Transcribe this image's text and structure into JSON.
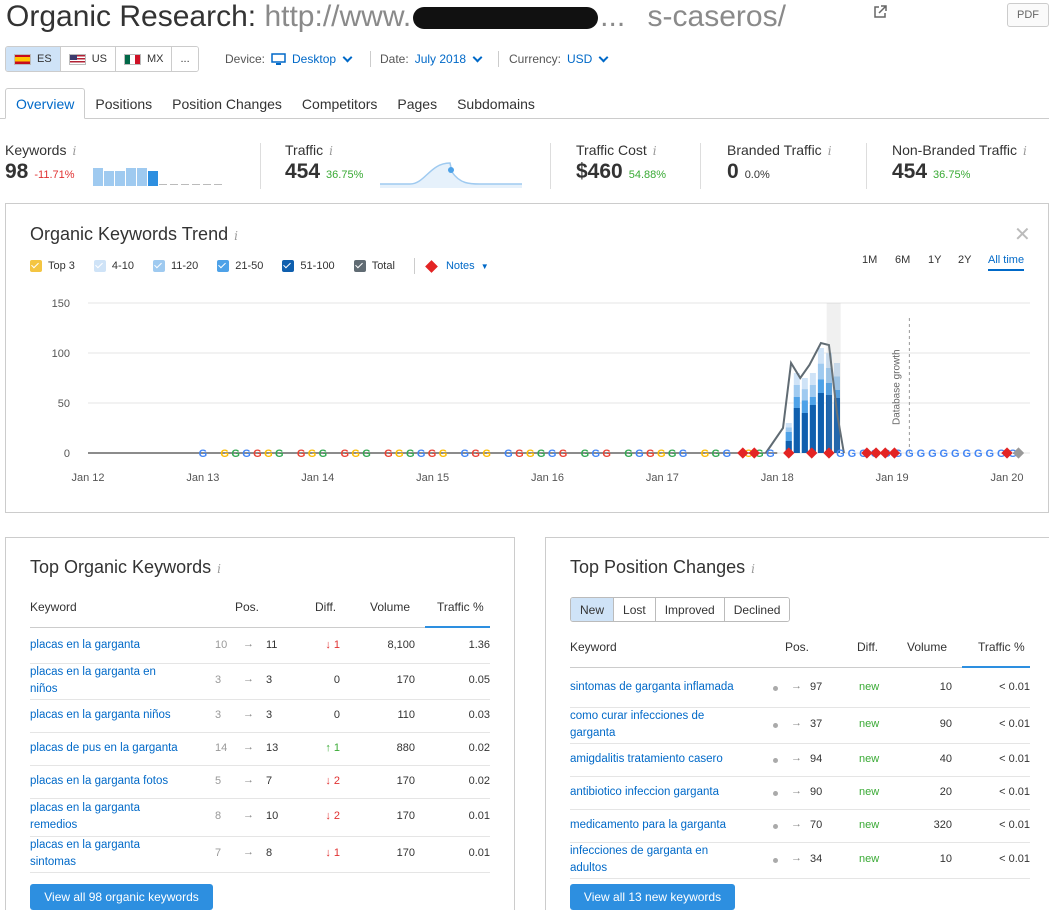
{
  "header": {
    "title_prefix": "Organic Research:",
    "url_start": "http://www.",
    "url_mid": "...",
    "url_end": "s-caseros/",
    "pdf_label": "PDF"
  },
  "databases": [
    {
      "code": "ES",
      "flag": "es",
      "active": true
    },
    {
      "code": "US",
      "flag": "us",
      "active": false
    },
    {
      "code": "MX",
      "flag": "mx",
      "active": false
    },
    {
      "code": "...",
      "flag": "",
      "active": false
    }
  ],
  "filters": {
    "device_label": "Device:",
    "device_value": "Desktop",
    "date_label": "Date:",
    "date_value": "July 2018",
    "currency_label": "Currency:",
    "currency_value": "USD"
  },
  "tabs": [
    "Overview",
    "Positions",
    "Position Changes",
    "Competitors",
    "Pages",
    "Subdomains"
  ],
  "metrics": {
    "keywords": {
      "label": "Keywords",
      "value": "98",
      "change": "-11.71%"
    },
    "traffic": {
      "label": "Traffic",
      "value": "454",
      "change": "36.75%"
    },
    "traffic_cost": {
      "label": "Traffic Cost",
      "value": "$460",
      "change": "54.88%"
    },
    "branded": {
      "label": "Branded Traffic",
      "value": "0",
      "change": "0.0%"
    },
    "non_branded": {
      "label": "Non-Branded Traffic",
      "value": "454",
      "change": "36.75%"
    }
  },
  "trend": {
    "title": "Organic Keywords Trend",
    "legend": [
      {
        "label": "Top 3",
        "color": "#f4c542"
      },
      {
        "label": "4-10",
        "color": "#cfe3f7"
      },
      {
        "label": "11-20",
        "color": "#9fcaf0"
      },
      {
        "label": "21-50",
        "color": "#4ea2e8"
      },
      {
        "label": "51-100",
        "color": "#0f5fae"
      },
      {
        "label": "Total",
        "color": "#606b73"
      }
    ],
    "notes_label": "Notes",
    "ranges": [
      "1M",
      "6M",
      "1Y",
      "2Y",
      "All time"
    ],
    "active_range": "All time",
    "annotation": "Database growth"
  },
  "chart_data": {
    "type": "area",
    "ylim": [
      0,
      150
    ],
    "y_ticks": [
      0,
      50,
      100,
      150
    ],
    "x_ticks": [
      "Jan 12",
      "Jan 13",
      "Jan 14",
      "Jan 15",
      "Jan 16",
      "Jan 17",
      "Jan 18",
      "Jan 19",
      "Jan 20"
    ],
    "series": [
      {
        "name": "Total",
        "x": [
          2012.0,
          2017.9,
          2018.05,
          2018.12,
          2018.2,
          2018.28,
          2018.38,
          2018.45,
          2018.52,
          2018.58
        ],
        "values": [
          0,
          0,
          25,
          90,
          75,
          88,
          110,
          108,
          40,
          0
        ]
      },
      {
        "name": "51-100",
        "x": [
          2018.05,
          2018.12,
          2018.2,
          2018.28,
          2018.38,
          2018.45,
          2018.52
        ],
        "values": [
          10,
          45,
          35,
          45,
          60,
          55,
          20
        ]
      }
    ]
  },
  "top_keywords": {
    "title": "Top Organic Keywords",
    "headers": [
      "Keyword",
      "Pos.",
      "Diff.",
      "Volume",
      "Traffic %"
    ],
    "rows": [
      {
        "keyword": "placas en la garganta",
        "prev": "10",
        "pos": "11",
        "diff": "1",
        "dir": "down",
        "volume": "8,100",
        "traffic": "1.36"
      },
      {
        "keyword": "placas en la garganta en niños",
        "prev": "3",
        "pos": "3",
        "diff": "0",
        "dir": "none",
        "volume": "170",
        "traffic": "0.05"
      },
      {
        "keyword": "placas en la garganta niños",
        "prev": "3",
        "pos": "3",
        "diff": "0",
        "dir": "none",
        "volume": "110",
        "traffic": "0.03"
      },
      {
        "keyword": "placas de pus en la garganta",
        "prev": "14",
        "pos": "13",
        "diff": "1",
        "dir": "up",
        "volume": "880",
        "traffic": "0.02"
      },
      {
        "keyword": "placas en la garganta fotos",
        "prev": "5",
        "pos": "7",
        "diff": "2",
        "dir": "down",
        "volume": "170",
        "traffic": "0.02"
      },
      {
        "keyword": "placas en la garganta remedios",
        "prev": "8",
        "pos": "10",
        "diff": "2",
        "dir": "down",
        "volume": "170",
        "traffic": "0.01"
      },
      {
        "keyword": "placas en la garganta sintomas",
        "prev": "7",
        "pos": "8",
        "diff": "1",
        "dir": "down",
        "volume": "170",
        "traffic": "0.01"
      }
    ],
    "button": "View all 98 organic keywords"
  },
  "position_changes": {
    "title": "Top Position Changes",
    "segments": [
      "New",
      "Lost",
      "Improved",
      "Declined"
    ],
    "active_segment": "New",
    "headers": [
      "Keyword",
      "Pos.",
      "Diff.",
      "Volume",
      "Traffic %"
    ],
    "rows": [
      {
        "keyword": "sintomas de garganta inflamada",
        "pos": "97",
        "diff": "new",
        "volume": "10",
        "traffic": "< 0.01"
      },
      {
        "keyword": "como curar infecciones de garganta",
        "pos": "37",
        "diff": "new",
        "volume": "90",
        "traffic": "< 0.01"
      },
      {
        "keyword": "amigdalitis tratamiento casero",
        "pos": "94",
        "diff": "new",
        "volume": "40",
        "traffic": "< 0.01"
      },
      {
        "keyword": "antibiotico infeccion garganta",
        "pos": "90",
        "diff": "new",
        "volume": "20",
        "traffic": "< 0.01"
      },
      {
        "keyword": "medicamento para la garganta",
        "pos": "70",
        "diff": "new",
        "volume": "320",
        "traffic": "< 0.01"
      },
      {
        "keyword": "infecciones de garganta en adultos",
        "pos": "34",
        "diff": "new",
        "volume": "10",
        "traffic": "< 0.01"
      }
    ],
    "button": "View all 13 new keywords"
  }
}
